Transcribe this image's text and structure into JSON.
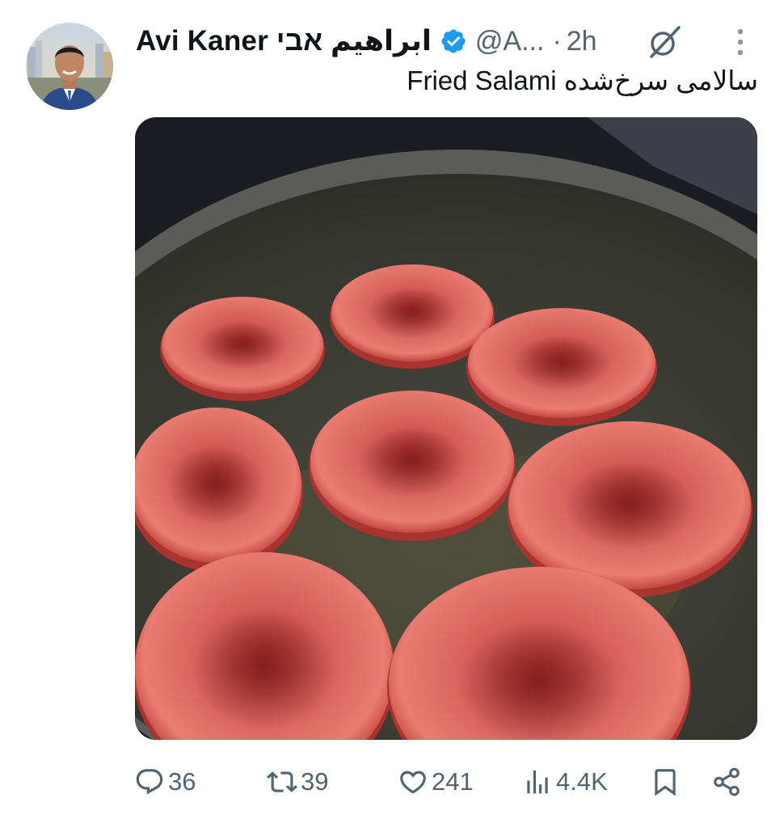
{
  "tweet": {
    "display_name": "Avi Kaner ابراهيم אבי",
    "handle": "@A...",
    "separator": "·",
    "time": "2h",
    "text": "Fried Salami سالامی سرخ‌شده"
  },
  "actions": {
    "replies": "36",
    "retweets": "39",
    "likes": "241",
    "views": "4.4K"
  },
  "icons": {
    "verified": "verified-badge-icon",
    "grok": "grok-icon",
    "more": "more-vertical-icon",
    "reply": "reply-icon",
    "retweet": "retweet-icon",
    "like": "heart-icon",
    "views": "views-chart-icon",
    "bookmark": "bookmark-icon",
    "share": "share-icon"
  },
  "colors": {
    "verified": "#1d9bf0",
    "text_primary": "#0f1419",
    "text_secondary": "#536471"
  }
}
